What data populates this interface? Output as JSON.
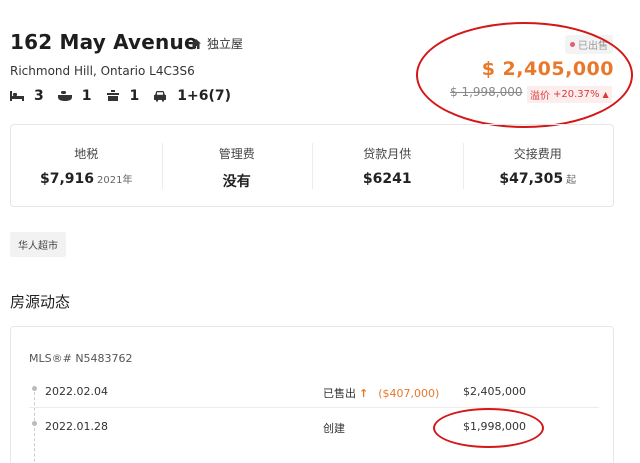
{
  "listing": {
    "title": "162 May Avenue",
    "property_type": "独立屋",
    "address": "Richmond Hill, Ontario L4C3S6",
    "bedrooms": "3",
    "bathrooms": "1",
    "kitchens": "1",
    "parking": "1+6(7)",
    "status": "已出售",
    "price": "$ 2,405,000",
    "original_price": "$ 1,998,000",
    "change_label": "溢价",
    "change_value": "+20.37%"
  },
  "stats": [
    {
      "label": "地税",
      "value": "$7,916",
      "suffix": "2021年"
    },
    {
      "label": "管理费",
      "value": "没有",
      "suffix": ""
    },
    {
      "label": "贷款月供",
      "value": "$6241",
      "suffix": ""
    },
    {
      "label": "交接费用",
      "value": "$47,305",
      "suffix": "起"
    }
  ],
  "tags": [
    "华人超市"
  ],
  "history": {
    "section_title": "房源动态",
    "mls": "MLS®# N5483762",
    "rows": [
      {
        "date": "2022.02.04",
        "event": "已售出",
        "diff": "($407,000)",
        "price": "$2,405,000"
      },
      {
        "date": "2022.01.28",
        "event": "创建",
        "diff": "",
        "price": "$1,998,000"
      }
    ]
  },
  "colors": {
    "accent": "#e8782a",
    "annotation": "#d41717",
    "badge_dot": "#e05d7a",
    "premium": "#d83a3a"
  }
}
